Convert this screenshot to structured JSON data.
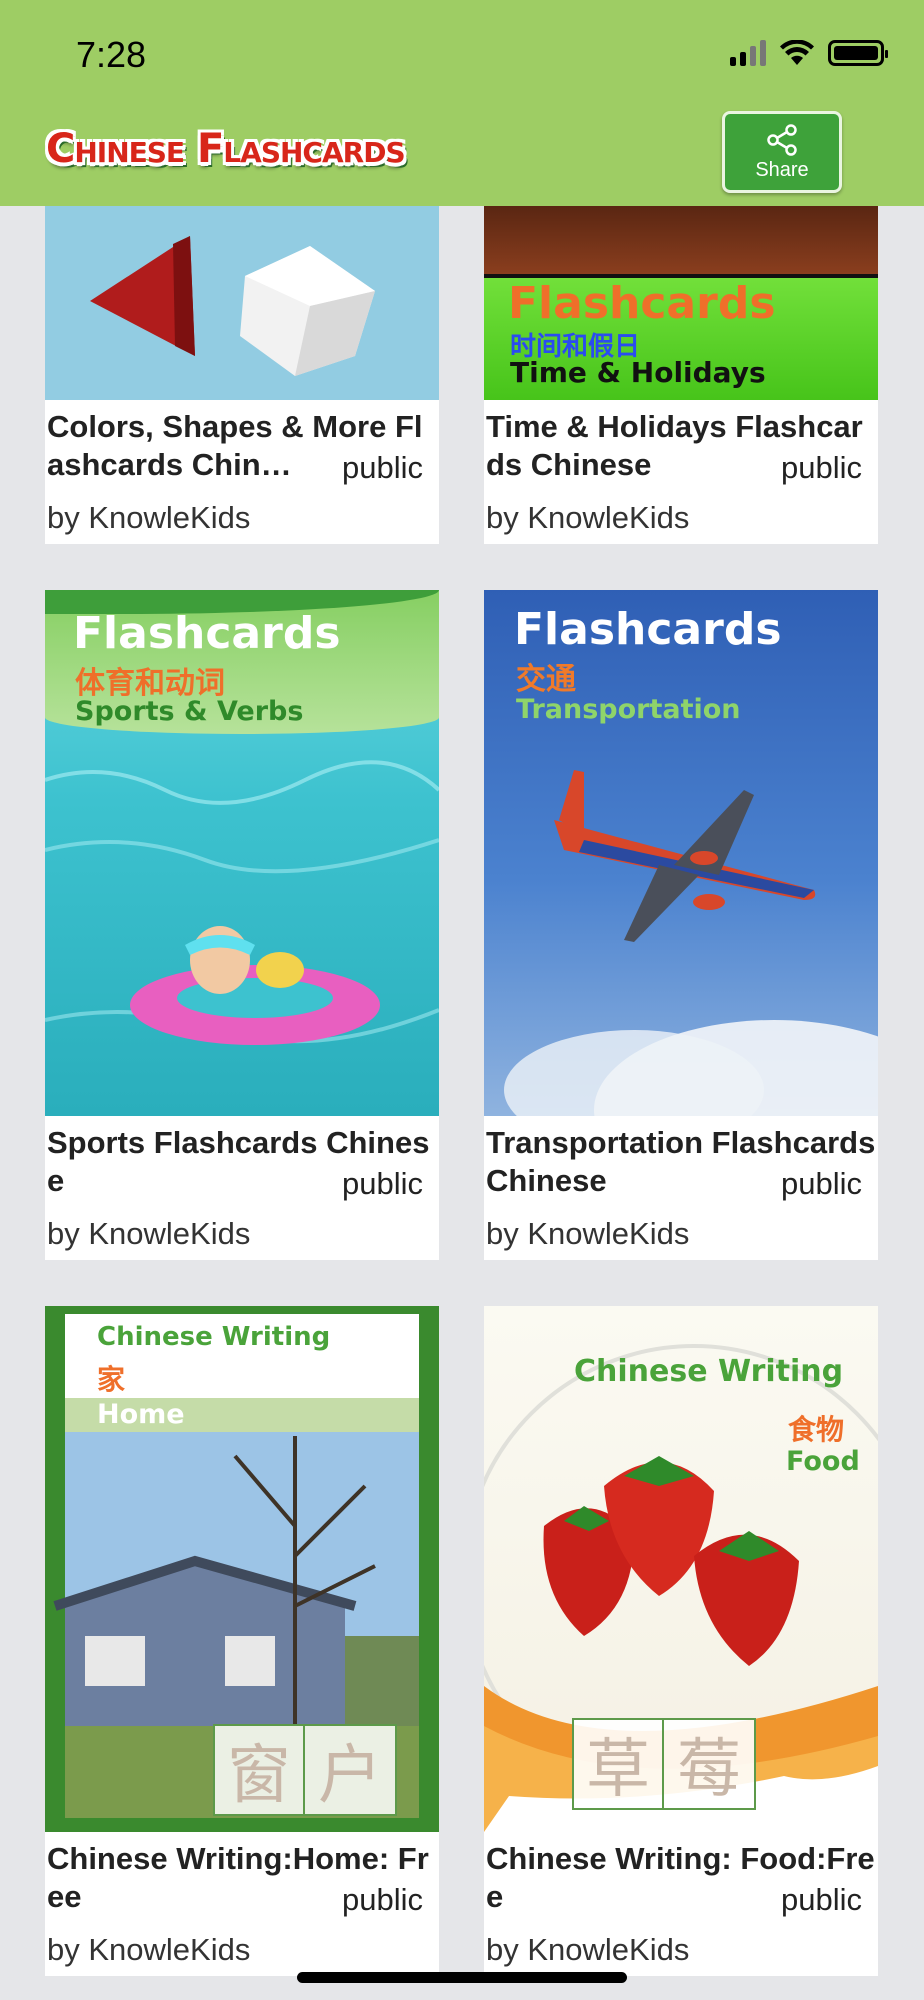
{
  "status_bar": {
    "time": "7:28"
  },
  "header": {
    "logo_text": "Chinese Flashcards",
    "share_label": "Share"
  },
  "cards": [
    {
      "title": "Colors, Shapes & More Flashcards Chin…",
      "visibility": "public",
      "author": "by KnowleKids"
    },
    {
      "title": "Time & Holidays Flashcards Chinese",
      "visibility": "public",
      "author": "by KnowleKids",
      "cover": {
        "heading": "Flashcards",
        "chinese": "时间和假日",
        "english": "Time & Holidays"
      }
    },
    {
      "title": "Sports Flashcards Chinese",
      "visibility": "public",
      "author": "by KnowleKids",
      "cover": {
        "heading": "Flashcards",
        "chinese": "体育和动词",
        "english": "Sports & Verbs"
      }
    },
    {
      "title": "Transportation Flashcards Chinese",
      "visibility": "public",
      "author": "by KnowleKids",
      "cover": {
        "heading": "Flashcards",
        "chinese": "交通",
        "english": "Transportation"
      }
    },
    {
      "title": "Chinese Writing:Home: Free",
      "visibility": "public",
      "author": "by KnowleKids",
      "cover": {
        "heading": "Chinese Writing",
        "chinese": "家",
        "english": "Home",
        "chars": [
          "窗",
          "户"
        ]
      }
    },
    {
      "title": "Chinese Writing: Food:Free",
      "visibility": "public",
      "author": "by KnowleKids",
      "cover": {
        "heading": "Chinese Writing",
        "chinese": "食物",
        "english": "Food",
        "chars": [
          "草",
          "莓"
        ]
      }
    }
  ],
  "colors": {
    "header_bg": "#9ecd64",
    "share_bg": "#3ea23a",
    "page_bg": "#e5e6e9"
  }
}
